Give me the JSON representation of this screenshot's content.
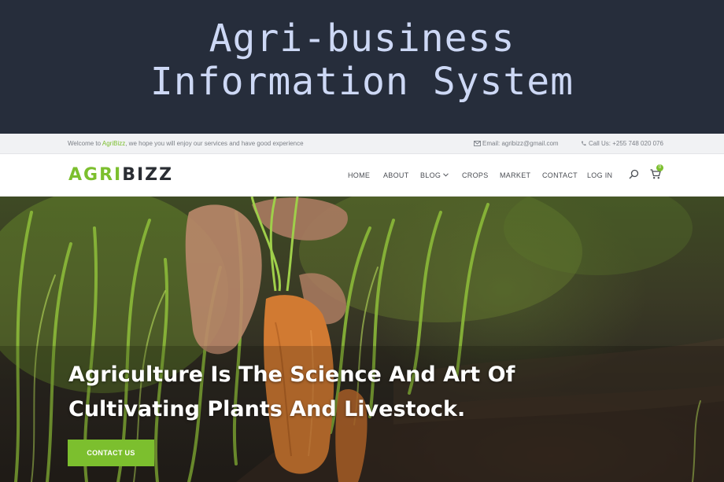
{
  "banner": {
    "title_line1": "Agri-business",
    "title_line2": "Information System"
  },
  "topbar": {
    "welcome_prefix": "Welcome to ",
    "welcome_brand": "AgriBizz",
    "welcome_suffix": ", we hope you will enjoy our services and have good experience",
    "email": "Email: agribizz@gmail.com",
    "phone": "Call Us: +255 748 020 076"
  },
  "logo": {
    "part1": "AGRI",
    "part2": "BIZZ"
  },
  "nav": {
    "home": "HOME",
    "about": "ABOUT",
    "blog": "BLOG",
    "crops": "CROPS",
    "market": "MARKET",
    "contact": "CONTACT",
    "login": "LOG IN",
    "cart_count": "0"
  },
  "hero": {
    "heading_line1": "Agriculture Is The Science And Art Of",
    "heading_line2": "Cultivating Plants And Livestock.",
    "button": "CONTACT US"
  },
  "colors": {
    "brand_green": "#7cbf2e",
    "banner_bg": "#262d3b",
    "banner_text": "#cdd8f5"
  },
  "icons": [
    "mail-icon",
    "phone-icon",
    "chevron-down-icon",
    "search-icon",
    "cart-icon"
  ]
}
